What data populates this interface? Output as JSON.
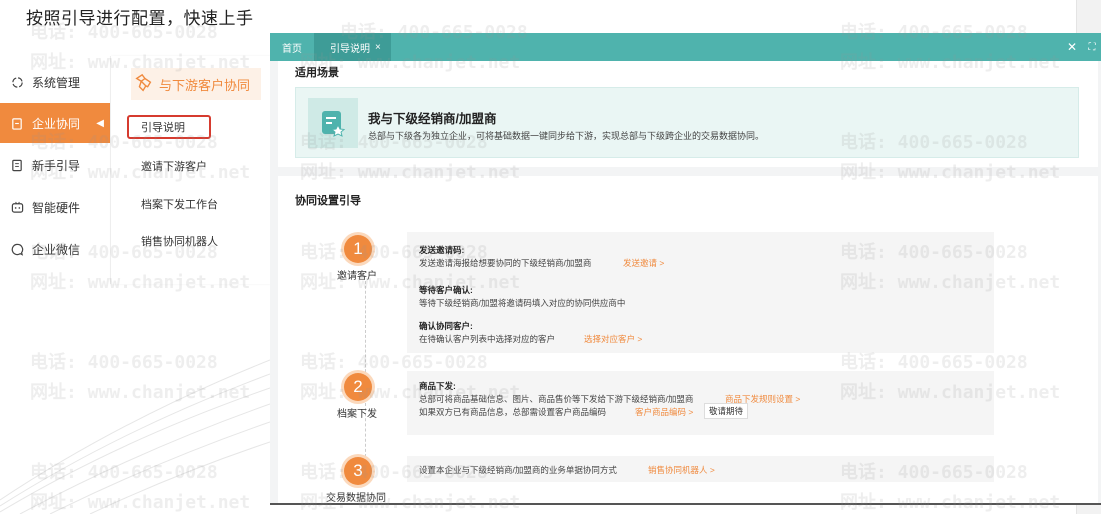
{
  "slide": {
    "title": "按照引导进行配置，快速上手"
  },
  "leftnav": {
    "items": [
      {
        "label": "系统管理",
        "icon": "gear-icon"
      },
      {
        "label": "企业协同",
        "icon": "clipboard-icon",
        "active": true
      },
      {
        "label": "新手引导",
        "icon": "document-icon"
      },
      {
        "label": "智能硬件",
        "icon": "device-icon"
      },
      {
        "label": "企业微信",
        "icon": "chat-icon"
      }
    ]
  },
  "submenu": {
    "header": "与下游客户协同",
    "items": [
      "引导说明",
      "邀请下游客户",
      "档案下发工作台",
      "销售协同机器人"
    ]
  },
  "tabs": {
    "home": "首页",
    "current": "引导说明"
  },
  "scene": {
    "section_title": "适用场景",
    "title": "我与下级经销商/加盟商",
    "desc": "总部与下级各为独立企业，可将基础数据一键同步给下游，实现总部与下级跨企业的交易数据协同。"
  },
  "guide": {
    "section_title": "协同设置引导",
    "steps": [
      {
        "number": "1",
        "label": "邀请客户",
        "blocks": [
          {
            "title": "发送邀请码:",
            "text": "发送邀请海报给想要协同的下级经销商/加盟商",
            "link": "发送邀请 >"
          },
          {
            "title": "等待客户确认:",
            "text": "等待下级经销商/加盟将邀请码填入对应的协同供应商中"
          },
          {
            "title": "确认协同客户:",
            "text": "在待确认客户列表中选择对应的客户",
            "link": "选择对应客户 >"
          }
        ]
      },
      {
        "number": "2",
        "label": "档案下发",
        "title": "商品下发:",
        "lines": [
          {
            "text": "总部可将商品基础信息、图片、商品售价等下发给下游下级经销商/加盟商",
            "link": "商品下发规则设置 >"
          },
          {
            "text": "如果双方已有商品信息，总部需设置客户商品编码",
            "link": "客户商品编码 >",
            "button": "敬请期待"
          }
        ]
      },
      {
        "number": "3",
        "label": "交易数据协同",
        "text": "设置本企业与下级经销商/加盟商的业务单据协同方式",
        "link": "销售协同机器人 >"
      }
    ]
  },
  "watermark": {
    "phone": "电话: 400-665-0028",
    "url": "网址: www.chanjet.net"
  },
  "colors": {
    "accent": "#f08a3e",
    "tabbar": "#4fb3ad",
    "highlight_box": "#d63b2f",
    "scene_bg": "#eaf6f4"
  }
}
